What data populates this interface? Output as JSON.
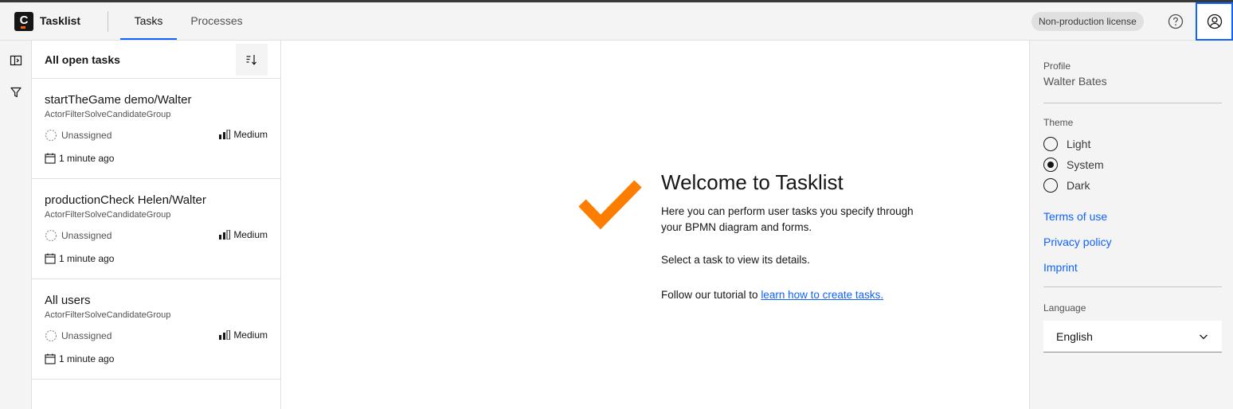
{
  "header": {
    "logo_letter": "C",
    "app_name": "Tasklist",
    "tabs": [
      {
        "label": "Tasks",
        "active": true
      },
      {
        "label": "Processes",
        "active": false
      }
    ],
    "license_badge": "Non-production license",
    "icons": [
      "help-icon",
      "user-avatar-icon"
    ]
  },
  "rail": {
    "icons": [
      "expand-panel-icon",
      "filter-icon"
    ]
  },
  "tasklist": {
    "title": "All open tasks",
    "sort_icon": "sort-icon",
    "tasks": [
      {
        "name": "startTheGame demo/Walter",
        "group": "ActorFilterSolveCandidateGroup",
        "assignee": "Unassigned",
        "priority": "Medium",
        "time": "1 minute ago"
      },
      {
        "name": "productionCheck Helen/Walter",
        "group": "ActorFilterSolveCandidateGroup",
        "assignee": "Unassigned",
        "priority": "Medium",
        "time": "1 minute ago"
      },
      {
        "name": "All users",
        "group": "ActorFilterSolveCandidateGroup",
        "assignee": "Unassigned",
        "priority": "Medium",
        "time": "1 minute ago"
      }
    ]
  },
  "main": {
    "title": "Welcome to Tasklist",
    "description": "Here you can perform user tasks you specify through your BPMN diagram and forms.",
    "select_hint": "Select a task to view its details.",
    "tutorial_prefix": "Follow our tutorial to ",
    "tutorial_link": "learn how to create tasks.",
    "accent_color": "#fc7d00"
  },
  "profile": {
    "profile_label": "Profile",
    "user_name": "Walter Bates",
    "theme_label": "Theme",
    "themes": [
      {
        "label": "Light",
        "checked": false
      },
      {
        "label": "System",
        "checked": true
      },
      {
        "label": "Dark",
        "checked": false
      }
    ],
    "links": [
      "Terms of use",
      "Privacy policy",
      "Imprint"
    ],
    "language_label": "Language",
    "language_value": "English"
  },
  "colors": {
    "brand_blue": "#0f62fe",
    "brand_orange": "#fc7d00"
  }
}
